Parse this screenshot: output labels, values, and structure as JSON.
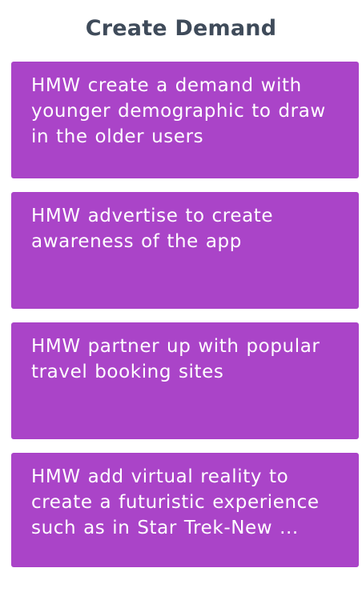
{
  "section": {
    "title": "Create Demand"
  },
  "cards": [
    {
      "text": "HMW create a demand with younger demographic to draw in the older users"
    },
    {
      "text": "HMW advertise to create awareness of the app"
    },
    {
      "text": "HMW partner up with popular travel booking sites"
    },
    {
      "text": "HMW add virtual reality to create a futuristic experience such as in Star Trek-New ..."
    }
  ],
  "colors": {
    "card_background": "#aa44c8",
    "card_text": "#ffffff",
    "title_text": "#3f4b5a"
  }
}
